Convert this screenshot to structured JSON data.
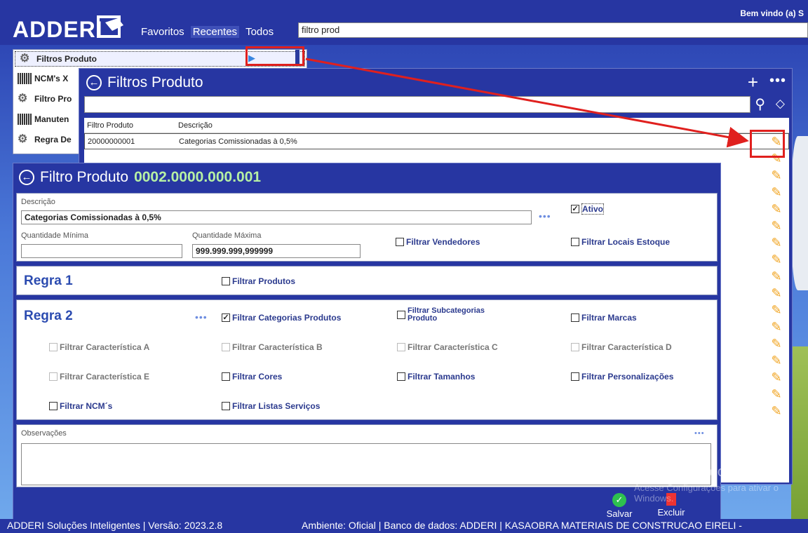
{
  "header": {
    "logo": "ADDERI",
    "nav": [
      "Favoritos",
      "Recentes",
      "Todos"
    ],
    "search_value": "filtro prod",
    "welcome": "Bem vindo (a) S"
  },
  "leftlist": {
    "items": [
      {
        "label": "Filtros Produto",
        "icon": "gear-icon"
      },
      {
        "label": "NCM's X",
        "icon": "barcode-icon"
      },
      {
        "label": "Filtro Pro",
        "icon": "gear-icon"
      },
      {
        "label": "Manuten",
        "icon": "barcode-icon"
      },
      {
        "label": "Regra De",
        "icon": "gear-icon"
      }
    ]
  },
  "filtros_window": {
    "title": "Filtros Produto",
    "columns": [
      "Filtro Produto",
      "Descrição"
    ],
    "rows": [
      {
        "code": "20000000001",
        "desc": "Categorias Comissionadas à 0,5%"
      }
    ]
  },
  "detail": {
    "title": "Filtro Produto",
    "code": "0002.0000.000.001",
    "descricao_label": "Descrição",
    "descricao_value": "Categorias Comissionadas à 0,5%",
    "ativo_label": "Ativo",
    "qtd_min_label": "Quantidade Mínima",
    "qtd_min_value": "",
    "qtd_max_label": "Quantidade Máxima",
    "qtd_max_value": "999.999.999,999999",
    "filtrar_vendedores": "Filtrar Vendedores",
    "filtrar_locais": "Filtrar Locais Estoque",
    "regra1": {
      "title": "Regra 1",
      "filtrar_produtos": "Filtrar Produtos"
    },
    "regra2": {
      "title": "Regra 2",
      "filtrar_categorias": "Filtrar Categorias Produtos",
      "filtrar_subcategorias": "Filtrar Subcategorias Produto",
      "filtrar_marcas": "Filtrar Marcas",
      "carac_a": "Filtrar Característica A",
      "carac_b": "Filtrar Característica B",
      "carac_c": "Filtrar Característica C",
      "carac_d": "Filtrar Característica D",
      "carac_e": "Filtrar Característica E",
      "cores": "Filtrar Cores",
      "tamanhos": "Filtrar Tamanhos",
      "personalizacoes": "Filtrar Personalizações",
      "ncms": "Filtrar NCM´s",
      "listas_servicos": "Filtrar Listas Serviços"
    },
    "observacoes_label": "Observações",
    "salvar": "Salvar",
    "excluir": "Excluir"
  },
  "watermark": {
    "line1": "Ativar o Windows",
    "line2": "Acesse Configurações para ativar o Windows."
  },
  "footer": {
    "left": "ADDERI Soluções Inteligentes | Versão: 2023.2.8",
    "right": "Ambiente: Oficial | Banco de dados: ADDERI | KASAOBRA MATERIAIS DE CONSTRUCAO EIRELI -"
  }
}
